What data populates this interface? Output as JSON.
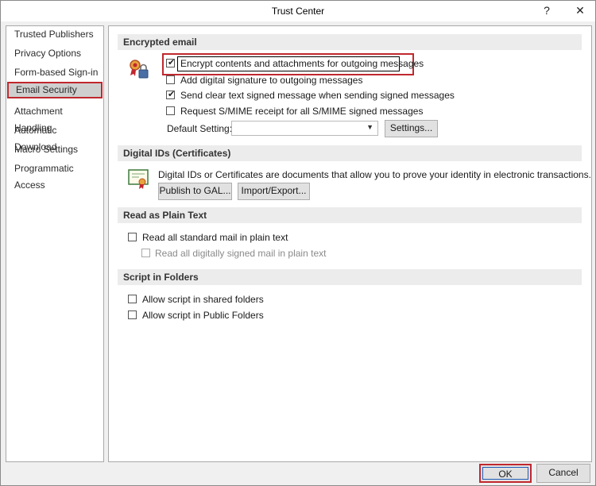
{
  "window": {
    "title": "Trust Center",
    "help_label": "?",
    "close_label": "✕"
  },
  "sidebar": {
    "items": [
      {
        "label": "Trusted Publishers"
      },
      {
        "label": "Privacy Options"
      },
      {
        "label": "Form-based Sign-in"
      },
      {
        "label": "Email Security",
        "selected": true
      },
      {
        "label": "Attachment Handling"
      },
      {
        "label": "Automatic Download"
      },
      {
        "label": "Macro Settings"
      },
      {
        "label": "Programmatic Access"
      }
    ]
  },
  "encrypted_email": {
    "header": "Encrypted email",
    "icon": "certificate-lock-icon",
    "encrypt_contents": {
      "label": "Encrypt contents and attachments for outgoing messages",
      "checked": true
    },
    "add_signature": {
      "label": "Add digital signature to outgoing messages",
      "checked": false
    },
    "clear_text": {
      "label": "Send clear text signed message when sending signed messages",
      "checked": true
    },
    "smime_receipt": {
      "label": "Request S/MIME receipt for all S/MIME signed messages",
      "checked": false
    },
    "default_setting_label": "Default Setting:",
    "default_setting_value": "",
    "settings_button": "Settings..."
  },
  "digital_ids": {
    "header": "Digital IDs (Certificates)",
    "icon": "certificate-icon",
    "description": "Digital IDs or Certificates are documents that allow you to prove your identity in electronic transactions.",
    "publish_button": "Publish to GAL...",
    "import_export_button": "Import/Export..."
  },
  "plain_text": {
    "header": "Read as Plain Text",
    "read_standard": {
      "label": "Read all standard mail in plain text",
      "checked": false
    },
    "read_signed": {
      "label": "Read all digitally signed mail in plain text",
      "checked": false,
      "disabled": true
    }
  },
  "script_folders": {
    "header": "Script in Folders",
    "shared": {
      "label": "Allow script in shared folders",
      "checked": false
    },
    "public": {
      "label": "Allow script in Public Folders",
      "checked": false
    }
  },
  "footer": {
    "ok_label": "OK",
    "cancel_label": "Cancel"
  },
  "colors": {
    "highlight": "#c0282e",
    "focus": "#1e5bb5"
  }
}
